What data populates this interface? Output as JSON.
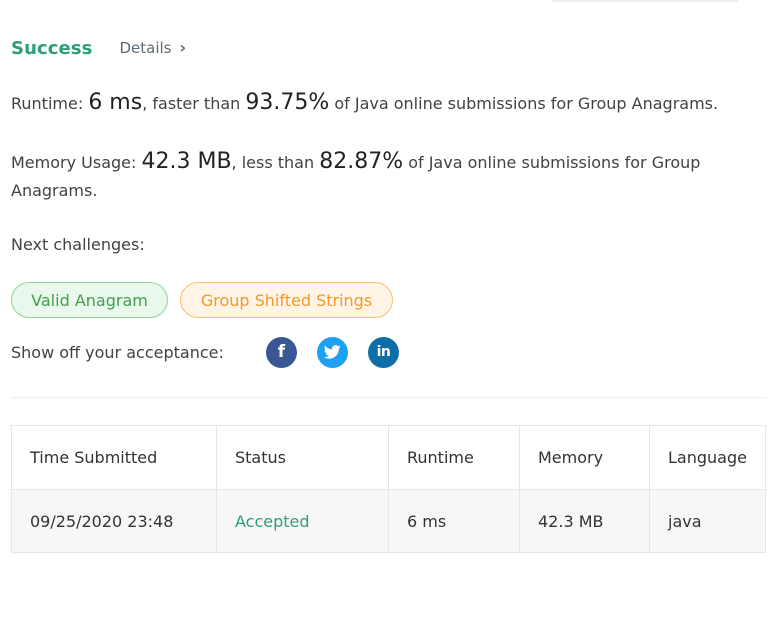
{
  "result": {
    "status": "Success",
    "details_label": "Details",
    "details_icon": "chevron-right-icon"
  },
  "runtime": {
    "label": "Runtime: ",
    "value": "6 ms",
    "text_faster": ", faster than ",
    "percent": "93.75%",
    "suffix": " of Java online submissions for Group Anagrams."
  },
  "memory": {
    "label": "Memory Usage: ",
    "value": "42.3 MB",
    "text_less": ", less than ",
    "percent": "82.87%",
    "suffix": " of Java online submissions for Group Anagrams."
  },
  "next_challenges": {
    "label": "Next challenges:",
    "items": [
      {
        "label": "Valid Anagram",
        "difficulty": "easy"
      },
      {
        "label": "Group Shifted Strings",
        "difficulty": "medium"
      }
    ]
  },
  "share": {
    "label": "Show off your acceptance:",
    "networks": [
      {
        "name": "facebook",
        "icon": "facebook-icon",
        "glyph": "f",
        "color": "#3a5795"
      },
      {
        "name": "twitter",
        "icon": "twitter-icon",
        "glyph": "",
        "color": "#1da1f2"
      },
      {
        "name": "linkedin",
        "icon": "linkedin-icon",
        "glyph": "in",
        "color": "#0e6ea8"
      }
    ]
  },
  "table": {
    "headers": [
      "Time Submitted",
      "Status",
      "Runtime",
      "Memory",
      "Language"
    ],
    "rows": [
      [
        "09/25/2020 23:48",
        "Accepted",
        "6 ms",
        "42.3 MB",
        "java"
      ]
    ]
  },
  "colors": {
    "success": "#2e9e7a",
    "easy": "#43a047",
    "medium": "#ef9a2a"
  }
}
